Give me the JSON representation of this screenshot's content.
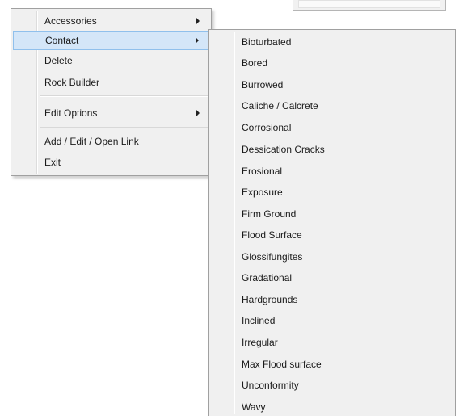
{
  "context_menu": {
    "items": [
      {
        "label": "Accessories",
        "has_submenu": true
      },
      {
        "label": "Contact",
        "has_submenu": true,
        "selected": true
      },
      {
        "label": "Delete",
        "has_submenu": false
      },
      {
        "label": "Rock Builder",
        "has_submenu": false
      },
      {
        "label": "Edit Options",
        "has_submenu": true
      },
      {
        "label": "Add / Edit / Open Link",
        "has_submenu": false
      },
      {
        "label": "Exit",
        "has_submenu": false
      }
    ]
  },
  "contact_submenu": {
    "items": [
      "Bioturbated",
      "Bored",
      "Burrowed",
      "Caliche / Calcrete",
      "Corrosional",
      "Dessication Cracks",
      "Erosional",
      "Exposure",
      "Firm Ground",
      "Flood Surface",
      "Glossifungites",
      "Gradational",
      "Hardgrounds",
      "Inclined",
      "Irregular",
      "Max Flood surface",
      "Unconformity",
      "Wavy"
    ]
  },
  "colors": {
    "menu_background": "#f0f0f0",
    "selection_fill": "#d4e6f8",
    "selection_border": "#90c0ec"
  }
}
